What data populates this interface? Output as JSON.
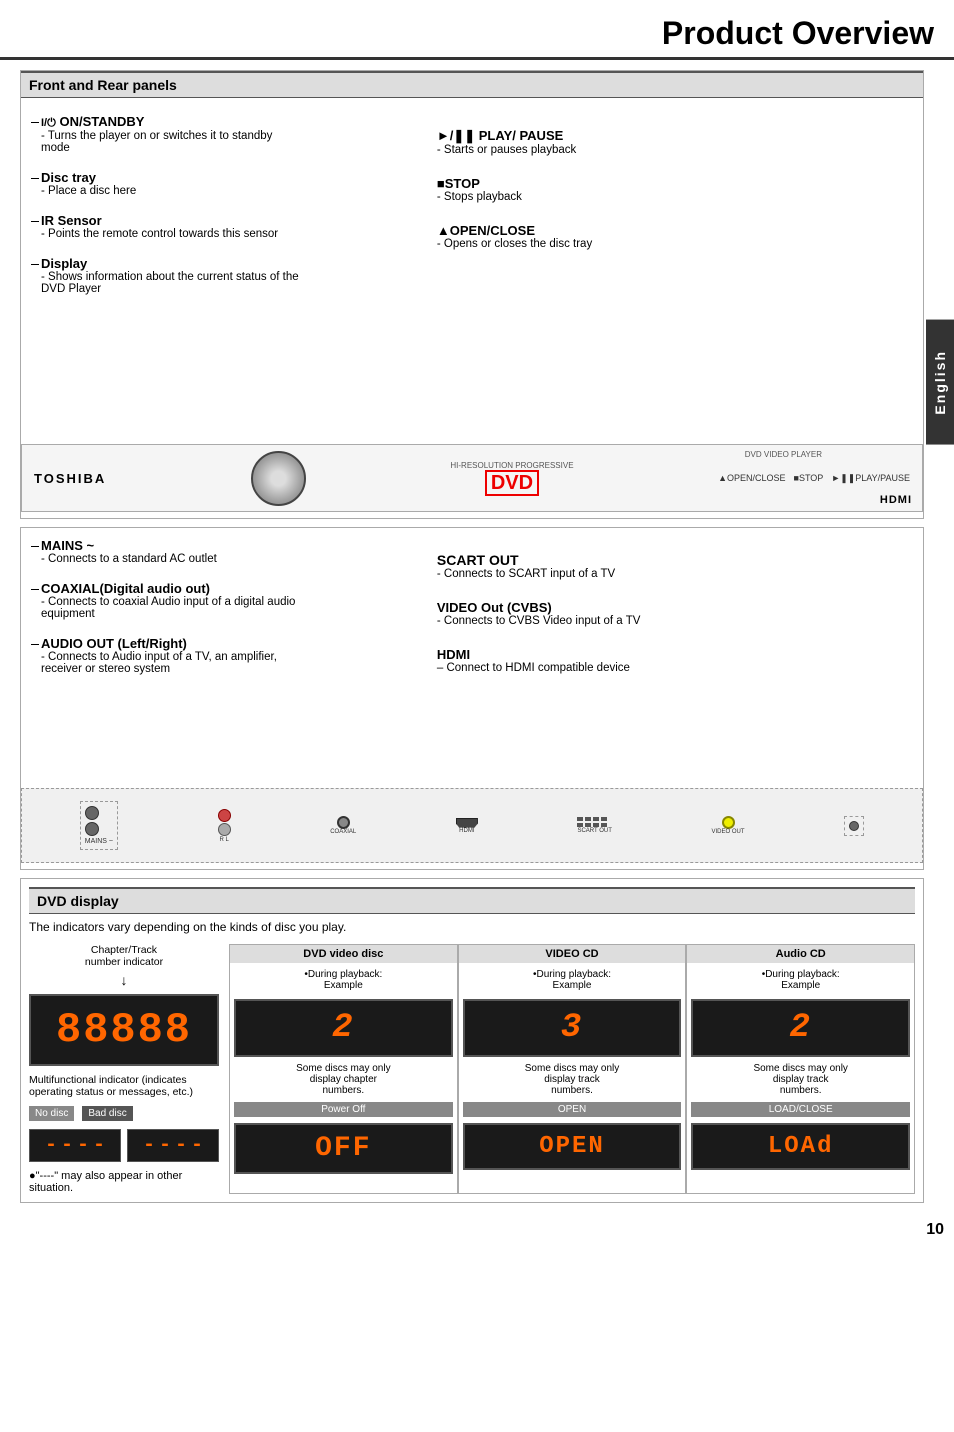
{
  "page": {
    "title": "Product Overview",
    "page_number": "10",
    "language_tab": "English"
  },
  "sections": {
    "front_rear": {
      "header": "Front and Rear panels",
      "front_items_left": [
        {
          "label": "I/⏻ ON/STANDBY",
          "desc_lines": [
            "- Turns the player on or switches it to standby",
            "mode"
          ]
        },
        {
          "label": "Disc tray",
          "desc_lines": [
            "- Place a disc here"
          ]
        },
        {
          "label": "IR Sensor",
          "desc_lines": [
            "- Points the remote control towards this sensor"
          ]
        },
        {
          "label": "Display",
          "desc_lines": [
            "- Shows information about the current status of the",
            "DVD Player"
          ]
        }
      ],
      "front_items_right": [
        {
          "label": "►/❚❚ PLAY/ PAUSE",
          "desc": "- Starts or pauses playback"
        },
        {
          "label": "■STOP",
          "desc": "- Stops playback"
        },
        {
          "label": "▲OPEN/CLOSE",
          "desc": "- Opens or closes the disc tray"
        }
      ],
      "device_brand": "TOSHIBA",
      "device_center_text": "HI-RESOLUTION PROGRESSIVE",
      "device_dvd_logo": "DVD",
      "device_right_buttons": "▲OPEN/CLOSE  ■STOP  ►❚❚PLAY/PAUSE",
      "device_hdmi": "HDMI",
      "device_dvd_label": "DVD VIDEO PLAYER"
    },
    "rear": {
      "rear_items_left": [
        {
          "label": "MAINS ~",
          "desc_lines": [
            "- Connects to a standard AC outlet"
          ]
        },
        {
          "label": "COAXIAL(Digital audio out)",
          "desc_lines": [
            "- Connects to coaxial Audio input of a digital audio",
            "equipment"
          ]
        },
        {
          "label": "AUDIO OUT (Left/Right)",
          "desc_lines": [
            "- Connects to Audio input of a TV, an amplifier,",
            "receiver or stereo system"
          ]
        }
      ],
      "rear_items_right": [
        {
          "label": "SCART OUT",
          "desc": "- Connects to SCART input of a TV"
        },
        {
          "label": "VIDEO Out (CVBS)",
          "desc": "- Connects to CVBS  Video input  of a TV"
        },
        {
          "label": "HDMI",
          "desc": "– Connect  to HDMI compatible  device"
        }
      ]
    },
    "dvd_display": {
      "header": "DVD display",
      "intro": "The indicators vary depending on the kinds of disc you play.",
      "chapter_track_label": "Chapter/Track\nnumber indicator",
      "main_lcd": "88888",
      "multifunctional_label": "Multifunctional indicator (indicates\noperating status or messages, etc.)",
      "badge_no_disc": "No disc",
      "badge_bad_disc": "Bad disc",
      "dashes_no_disc": "- - - -",
      "dashes_bad_disc": "- - - -",
      "bullet_note": "●\"----\" may also appear in other\nsituation.",
      "columns": [
        {
          "header": "DVD video disc",
          "sub": "•During playback:\nExample",
          "lcd_value": "2",
          "note": "Some discs may only\ndisplay chapter\nnumbers.",
          "row2_header": "Power Off",
          "row2_lcd": "OFF"
        },
        {
          "header": "VIDEO CD",
          "sub": "•During playback:\nExample",
          "lcd_value": "3",
          "note": "Some discs may only\ndisplay track\nnumbers.",
          "row2_header": "OPEN",
          "row2_lcd": "OPEN"
        },
        {
          "header": "Audio CD",
          "sub": "•During playback:\nExample",
          "lcd_value": "2",
          "note": "Some discs may only\ndisplay track\nnumbers.",
          "row2_header": "LOAD/CLOSE",
          "row2_lcd": "LOAd"
        }
      ]
    }
  }
}
